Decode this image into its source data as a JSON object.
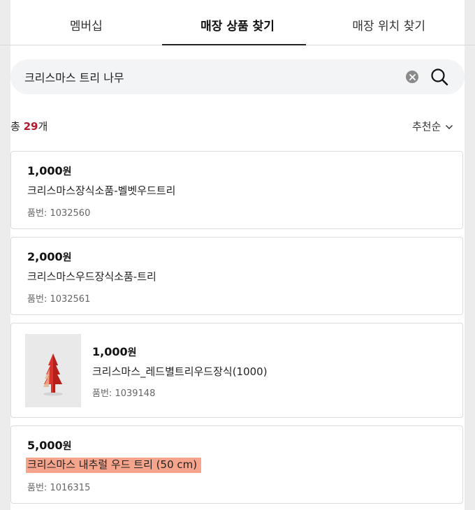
{
  "tabs": [
    {
      "label": "멤버십",
      "active": false
    },
    {
      "label": "매장 상품 찾기",
      "active": true
    },
    {
      "label": "매장 위치 찾기",
      "active": false
    }
  ],
  "search": {
    "value": "크리스마스 트리 나무",
    "clear_icon": "close-icon",
    "search_icon": "search-icon"
  },
  "result": {
    "prefix": "총 ",
    "count": "29",
    "suffix": "개"
  },
  "sort": {
    "label": "추천순",
    "icon": "chevron-down-icon"
  },
  "products": [
    {
      "price": "1,000",
      "currency": "원",
      "name": "크리스마스장식소품-벨벳우드트리",
      "number_label": "품번",
      "number": "1032560",
      "has_image": false
    },
    {
      "price": "2,000",
      "currency": "원",
      "name": "크리스마스우드장식소품-트리",
      "number_label": "품번",
      "number": "1032561",
      "has_image": false
    },
    {
      "price": "1,000",
      "currency": "원",
      "name": "크리스마스_레드별트리우드장식(1000)",
      "number_label": "품번",
      "number": "1039148",
      "has_image": true,
      "image_icon": "red-tree-image"
    },
    {
      "price": "5,000",
      "currency": "원",
      "name": "크리스마스 내추럴 우드 트리 (50 cm)",
      "number_label": "품번",
      "number": "1016315",
      "has_image": false,
      "highlighted": true
    }
  ],
  "colors": {
    "accent_red": "#b8162b",
    "highlight": "#f6a58c",
    "search_bg": "#f3f4f6"
  }
}
